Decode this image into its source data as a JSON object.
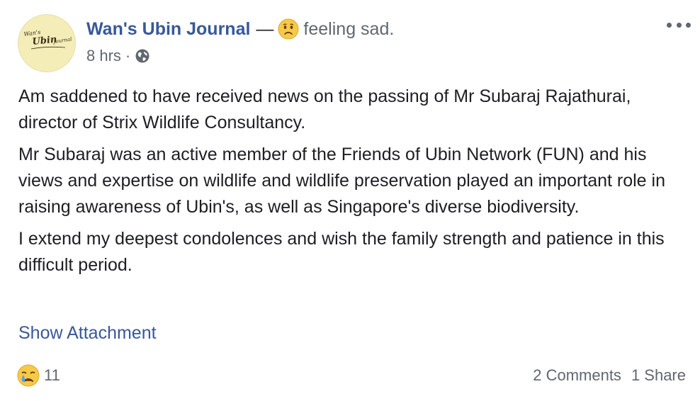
{
  "post": {
    "page_name": "Wan's Ubin Journal",
    "dash": "—",
    "feeling_icon": "sad-face-icon",
    "feeling_text": "feeling sad.",
    "timestamp": "8 hrs",
    "separator": "·",
    "audience_icon": "globe-icon",
    "more_icon": "more-options-icon",
    "avatar_logo_text": [
      "Wan's",
      "Ubin",
      "Journal"
    ],
    "paragraphs": [
      "Am saddened to have received news on the passing of Mr Subaraj Rajathurai, director of Strix Wildlife Consultancy.",
      "Mr Subaraj was an active member of the Friends of Ubin Network (FUN) and his views and expertise on wildlife and wildlife preservation played an important role in raising awareness of Ubin's, as well as Singapore's diverse biodiversity.",
      "I extend my deepest condolences and wish the family strength and patience in this difficult period."
    ],
    "show_attachment": "Show Attachment",
    "reaction_icon": "crying-face-icon",
    "reaction_count": "11",
    "comments": "2 Comments",
    "shares": "1 Share"
  },
  "colors": {
    "link_blue": "#385898",
    "text": "#1c1e21",
    "secondary_text": "#606770",
    "avatar_bg": "#f4edb8",
    "emoji_yellow": "#f7c948"
  }
}
